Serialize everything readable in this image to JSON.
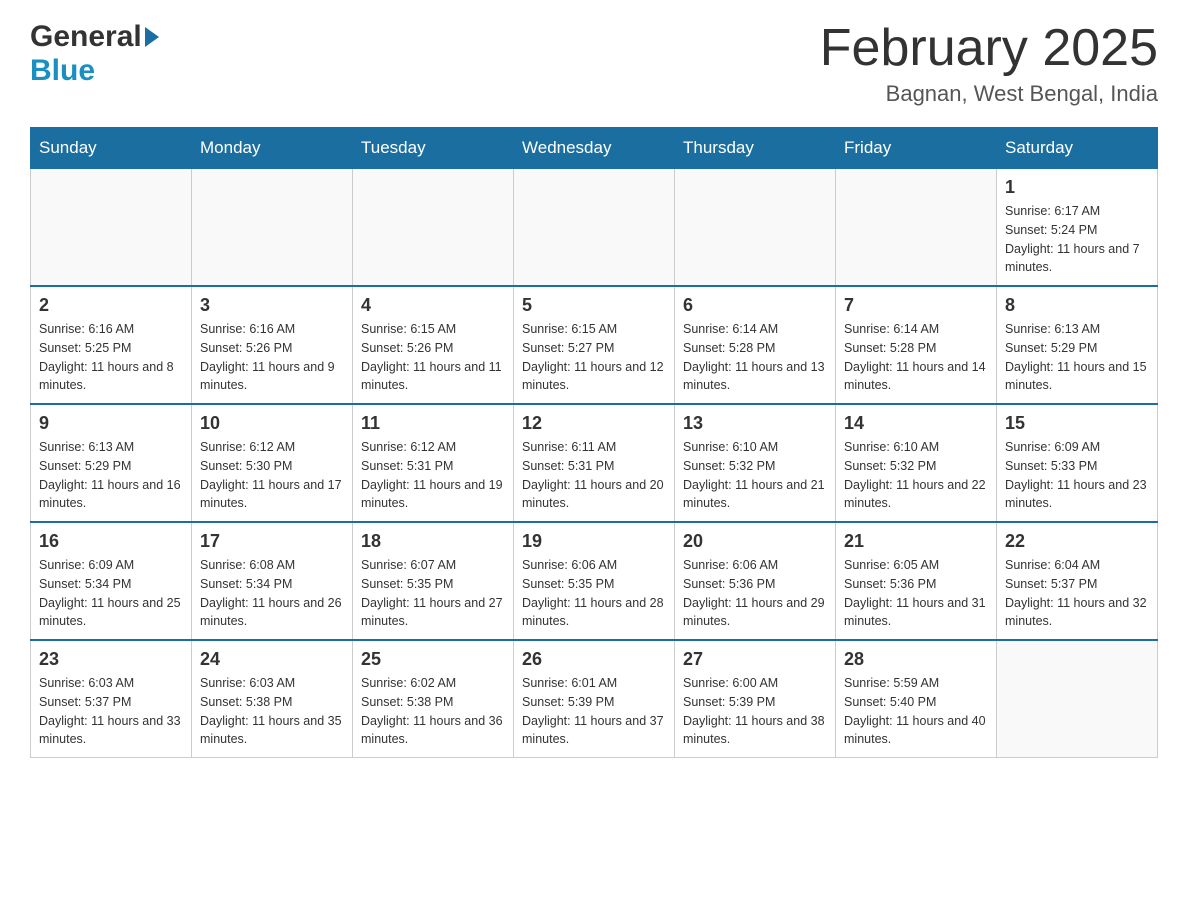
{
  "header": {
    "logo_general": "General",
    "logo_blue": "Blue",
    "month_title": "February 2025",
    "location": "Bagnan, West Bengal, India"
  },
  "weekdays": [
    "Sunday",
    "Monday",
    "Tuesday",
    "Wednesday",
    "Thursday",
    "Friday",
    "Saturday"
  ],
  "weeks": [
    [
      {
        "day": "",
        "info": ""
      },
      {
        "day": "",
        "info": ""
      },
      {
        "day": "",
        "info": ""
      },
      {
        "day": "",
        "info": ""
      },
      {
        "day": "",
        "info": ""
      },
      {
        "day": "",
        "info": ""
      },
      {
        "day": "1",
        "info": "Sunrise: 6:17 AM\nSunset: 5:24 PM\nDaylight: 11 hours and 7 minutes."
      }
    ],
    [
      {
        "day": "2",
        "info": "Sunrise: 6:16 AM\nSunset: 5:25 PM\nDaylight: 11 hours and 8 minutes."
      },
      {
        "day": "3",
        "info": "Sunrise: 6:16 AM\nSunset: 5:26 PM\nDaylight: 11 hours and 9 minutes."
      },
      {
        "day": "4",
        "info": "Sunrise: 6:15 AM\nSunset: 5:26 PM\nDaylight: 11 hours and 11 minutes."
      },
      {
        "day": "5",
        "info": "Sunrise: 6:15 AM\nSunset: 5:27 PM\nDaylight: 11 hours and 12 minutes."
      },
      {
        "day": "6",
        "info": "Sunrise: 6:14 AM\nSunset: 5:28 PM\nDaylight: 11 hours and 13 minutes."
      },
      {
        "day": "7",
        "info": "Sunrise: 6:14 AM\nSunset: 5:28 PM\nDaylight: 11 hours and 14 minutes."
      },
      {
        "day": "8",
        "info": "Sunrise: 6:13 AM\nSunset: 5:29 PM\nDaylight: 11 hours and 15 minutes."
      }
    ],
    [
      {
        "day": "9",
        "info": "Sunrise: 6:13 AM\nSunset: 5:29 PM\nDaylight: 11 hours and 16 minutes."
      },
      {
        "day": "10",
        "info": "Sunrise: 6:12 AM\nSunset: 5:30 PM\nDaylight: 11 hours and 17 minutes."
      },
      {
        "day": "11",
        "info": "Sunrise: 6:12 AM\nSunset: 5:31 PM\nDaylight: 11 hours and 19 minutes."
      },
      {
        "day": "12",
        "info": "Sunrise: 6:11 AM\nSunset: 5:31 PM\nDaylight: 11 hours and 20 minutes."
      },
      {
        "day": "13",
        "info": "Sunrise: 6:10 AM\nSunset: 5:32 PM\nDaylight: 11 hours and 21 minutes."
      },
      {
        "day": "14",
        "info": "Sunrise: 6:10 AM\nSunset: 5:32 PM\nDaylight: 11 hours and 22 minutes."
      },
      {
        "day": "15",
        "info": "Sunrise: 6:09 AM\nSunset: 5:33 PM\nDaylight: 11 hours and 23 minutes."
      }
    ],
    [
      {
        "day": "16",
        "info": "Sunrise: 6:09 AM\nSunset: 5:34 PM\nDaylight: 11 hours and 25 minutes."
      },
      {
        "day": "17",
        "info": "Sunrise: 6:08 AM\nSunset: 5:34 PM\nDaylight: 11 hours and 26 minutes."
      },
      {
        "day": "18",
        "info": "Sunrise: 6:07 AM\nSunset: 5:35 PM\nDaylight: 11 hours and 27 minutes."
      },
      {
        "day": "19",
        "info": "Sunrise: 6:06 AM\nSunset: 5:35 PM\nDaylight: 11 hours and 28 minutes."
      },
      {
        "day": "20",
        "info": "Sunrise: 6:06 AM\nSunset: 5:36 PM\nDaylight: 11 hours and 29 minutes."
      },
      {
        "day": "21",
        "info": "Sunrise: 6:05 AM\nSunset: 5:36 PM\nDaylight: 11 hours and 31 minutes."
      },
      {
        "day": "22",
        "info": "Sunrise: 6:04 AM\nSunset: 5:37 PM\nDaylight: 11 hours and 32 minutes."
      }
    ],
    [
      {
        "day": "23",
        "info": "Sunrise: 6:03 AM\nSunset: 5:37 PM\nDaylight: 11 hours and 33 minutes."
      },
      {
        "day": "24",
        "info": "Sunrise: 6:03 AM\nSunset: 5:38 PM\nDaylight: 11 hours and 35 minutes."
      },
      {
        "day": "25",
        "info": "Sunrise: 6:02 AM\nSunset: 5:38 PM\nDaylight: 11 hours and 36 minutes."
      },
      {
        "day": "26",
        "info": "Sunrise: 6:01 AM\nSunset: 5:39 PM\nDaylight: 11 hours and 37 minutes."
      },
      {
        "day": "27",
        "info": "Sunrise: 6:00 AM\nSunset: 5:39 PM\nDaylight: 11 hours and 38 minutes."
      },
      {
        "day": "28",
        "info": "Sunrise: 5:59 AM\nSunset: 5:40 PM\nDaylight: 11 hours and 40 minutes."
      },
      {
        "day": "",
        "info": ""
      }
    ]
  ]
}
